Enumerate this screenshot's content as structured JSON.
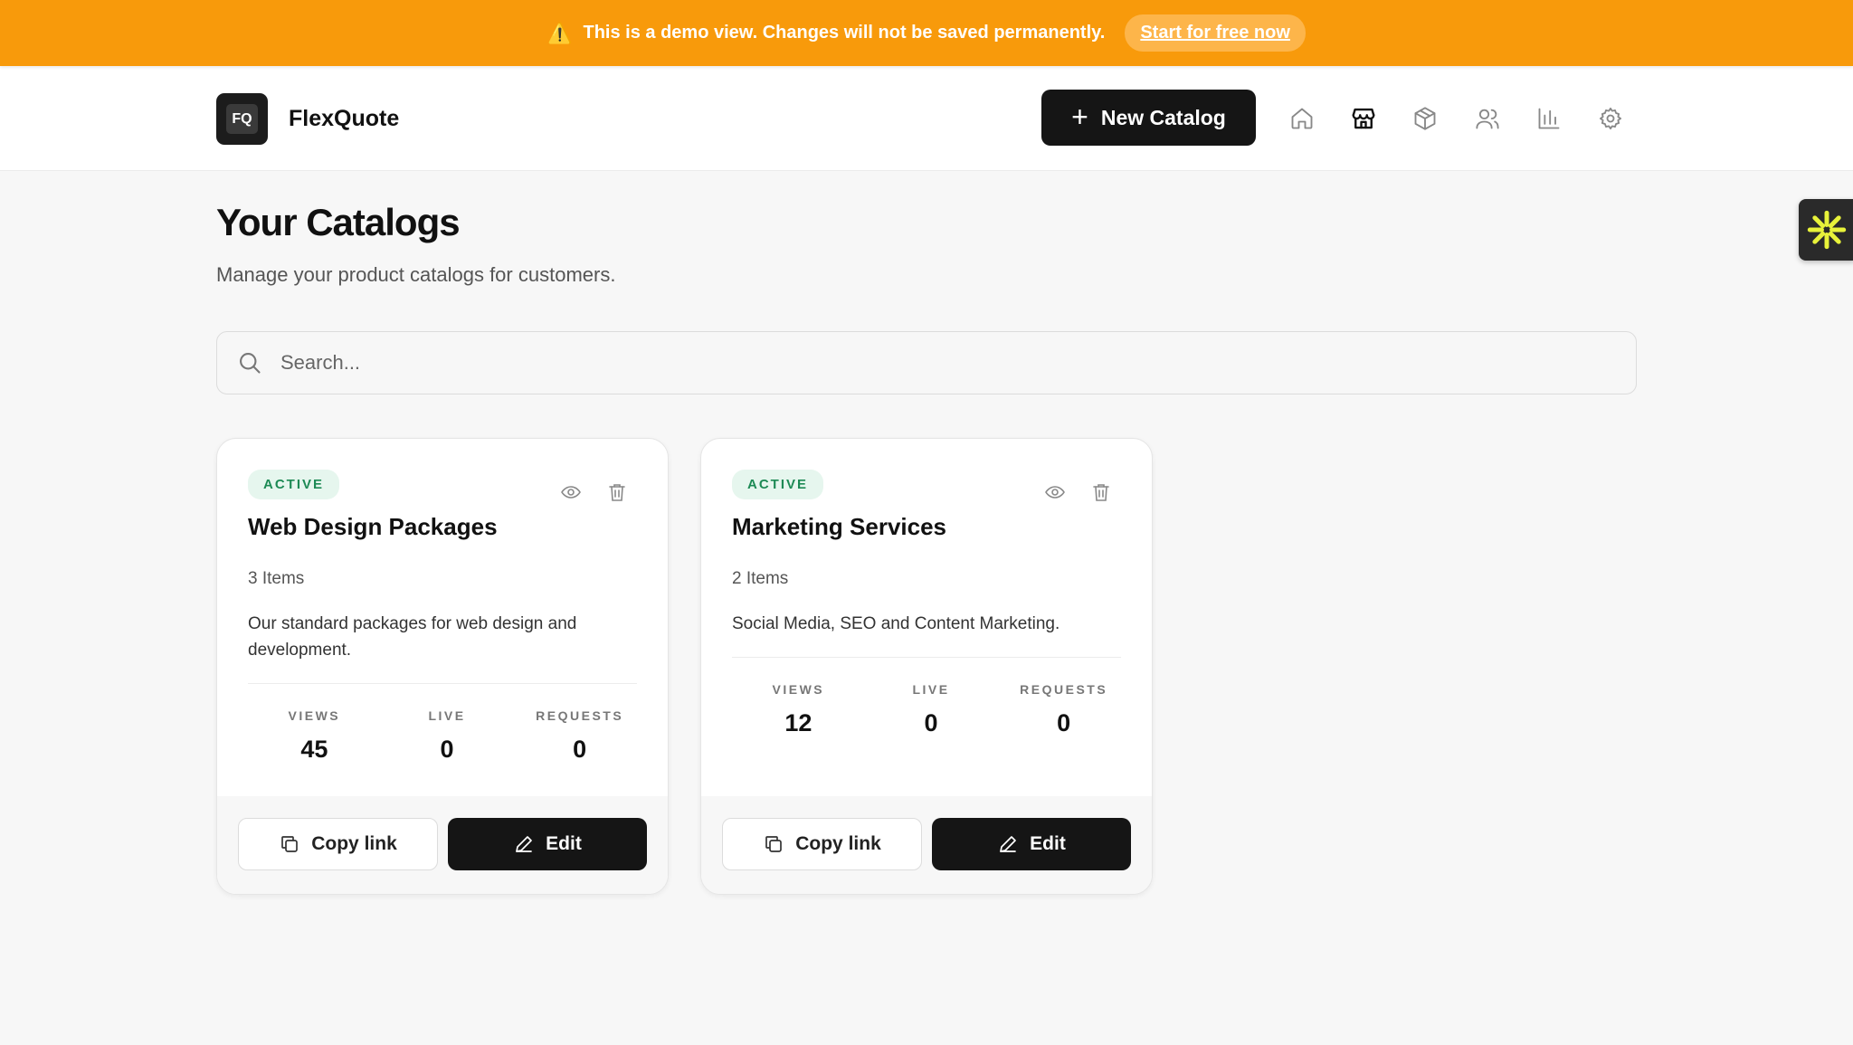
{
  "banner": {
    "message": "This is a demo view. Changes will not be saved permanently.",
    "cta": "Start for free now",
    "warning_icon": "⚠️"
  },
  "header": {
    "logo_text": "FQ",
    "brand": "FlexQuote",
    "new_button": "New Catalog",
    "nav_icons": [
      "home-icon",
      "store-icon",
      "package-icon",
      "users-icon",
      "chart-icon",
      "settings-icon"
    ]
  },
  "page": {
    "title": "Your Catalogs",
    "subtitle": "Manage your product catalogs for customers."
  },
  "search": {
    "placeholder": "Search..."
  },
  "catalogs": [
    {
      "status": "ACTIVE",
      "title": "Web Design Packages",
      "items": "3 Items",
      "description": "Our standard packages for web design and development.",
      "stats": [
        {
          "label": "VIEWS",
          "value": "45"
        },
        {
          "label": "LIVE",
          "value": "0"
        },
        {
          "label": "REQUESTS",
          "value": "0"
        }
      ],
      "copy_label": "Copy link",
      "edit_label": "Edit"
    },
    {
      "status": "ACTIVE",
      "title": "Marketing Services",
      "items": "2 Items",
      "description": "Social Media, SEO and Content Marketing.",
      "stats": [
        {
          "label": "VIEWS",
          "value": "12"
        },
        {
          "label": "LIVE",
          "value": "0"
        },
        {
          "label": "REQUESTS",
          "value": "0"
        }
      ],
      "copy_label": "Copy link",
      "edit_label": "Edit"
    }
  ],
  "colors": {
    "banner": "#f89a0b",
    "primary": "#151515",
    "active_badge_bg": "#e6f6ee",
    "active_badge_text": "#1d8a55",
    "widget_accent": "#e8f23a"
  }
}
